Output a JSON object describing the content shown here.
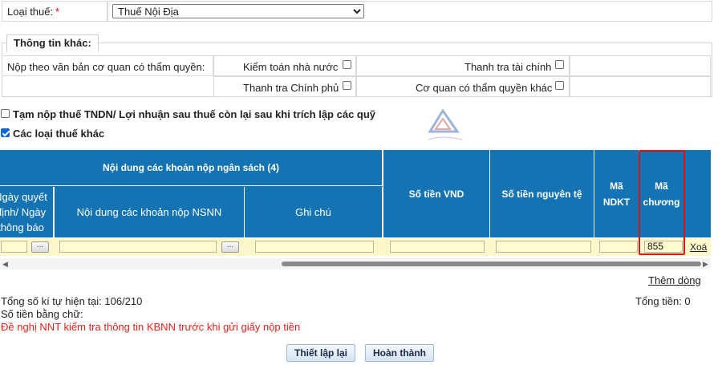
{
  "tax_type": {
    "label": "Loại thuế:",
    "required_mark": "*",
    "selected": "Thuế Nội Địa"
  },
  "other_info": {
    "legend": "Thông tin khác:",
    "submit_by_label": "Nộp theo văn bản cơ quan có thẩm quyền:",
    "options": {
      "state_audit": "Kiểm toán nhà nước",
      "financial_inspection": "Thanh tra tài chính",
      "government_inspection": "Thanh tra Chính phủ",
      "other_authority": "Cơ quan có thẩm quyền khác"
    }
  },
  "checks": {
    "provisional_label": "Tạm nộp thuế TNDN/ Lợi nhuận sau thuế còn lại sau khi trích lập các quỹ",
    "other_taxes_label": "Các loại thuế khác"
  },
  "grid": {
    "group_header": "Nội dung các khoản nộp ngân sách (4)",
    "columns": {
      "decision_date": "Ngày quyết định/ Ngày thông báo",
      "content_nsnn": "Nội dung các khoản nộp NSNN",
      "note": "Ghi chú",
      "amount_vnd": "Số tiền VND",
      "amount_original": "Số tiền nguyên tệ",
      "ma_ndkt": "Mã NDKT",
      "ma_chuong": "Mã chương"
    },
    "row": {
      "ma_chuong_value": "855",
      "delete_link": "Xoá",
      "picker_label": "..."
    },
    "add_row_link": "Thêm dòng"
  },
  "summary": {
    "char_count": "Tổng số kí tự hiện tại: 106/210",
    "total": "Tổng tiền: 0",
    "amount_in_words": "Số tiền bằng chữ:",
    "warning": "Đề nghị NNT kiểm tra thông tin KBNN trước khi gửi giấy nộp tiền"
  },
  "buttons": {
    "reset": "Thiết lập lại",
    "finish": "Hoàn thành"
  },
  "colors": {
    "header_blue": "#1473b3",
    "row_yellow": "#fff7c9",
    "highlight_red": "#d9141a",
    "warning_red": "#e8241a"
  }
}
